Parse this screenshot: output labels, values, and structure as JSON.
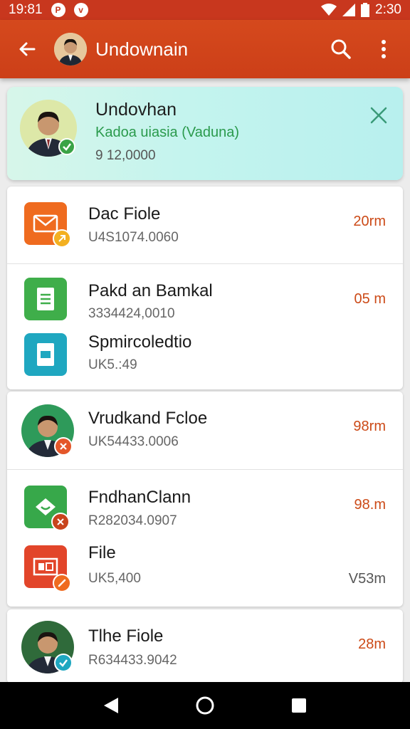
{
  "status_bar": {
    "time_left": "19:81",
    "time_right": "2:30"
  },
  "app_bar": {
    "title": "Undownain"
  },
  "banner": {
    "title": "Undovhan",
    "subtitle": "Kadoa uiasia (Vaduna)",
    "number": "9 12,0000"
  },
  "items": [
    {
      "name": "Dac Fiole",
      "meta": "U4S1074.0060",
      "time": "20rm",
      "icon": "email-icon",
      "color": "#ef6b1f"
    },
    {
      "name": "Pakd an Bamkal",
      "meta": "3334424,0010",
      "time": "05 m",
      "icon": "document-icon",
      "color": "#3fae4a"
    },
    {
      "name": "Spmircoledtio",
      "meta": "UK5.:49",
      "time": "",
      "icon": "slides-icon",
      "color": "#1fa7c0"
    },
    {
      "name": "Vrudkand Fcloe",
      "meta": "UK54433.0006",
      "time": "98rm",
      "icon": "person-avatar",
      "color": "#2e9a5a"
    },
    {
      "name": "FndhanClann",
      "meta": "R282034.0907",
      "time": "98.m",
      "icon": "map-icon",
      "color": "#37a84a"
    },
    {
      "name": "File",
      "meta": "UK5,400",
      "time": "V53m",
      "icon": "presentation-icon",
      "color": "#e2452a"
    },
    {
      "name": "Tlhe Fiole",
      "meta": "R634433.9042",
      "time": "28m",
      "icon": "person-avatar",
      "color": "#2f6a3a"
    }
  ]
}
